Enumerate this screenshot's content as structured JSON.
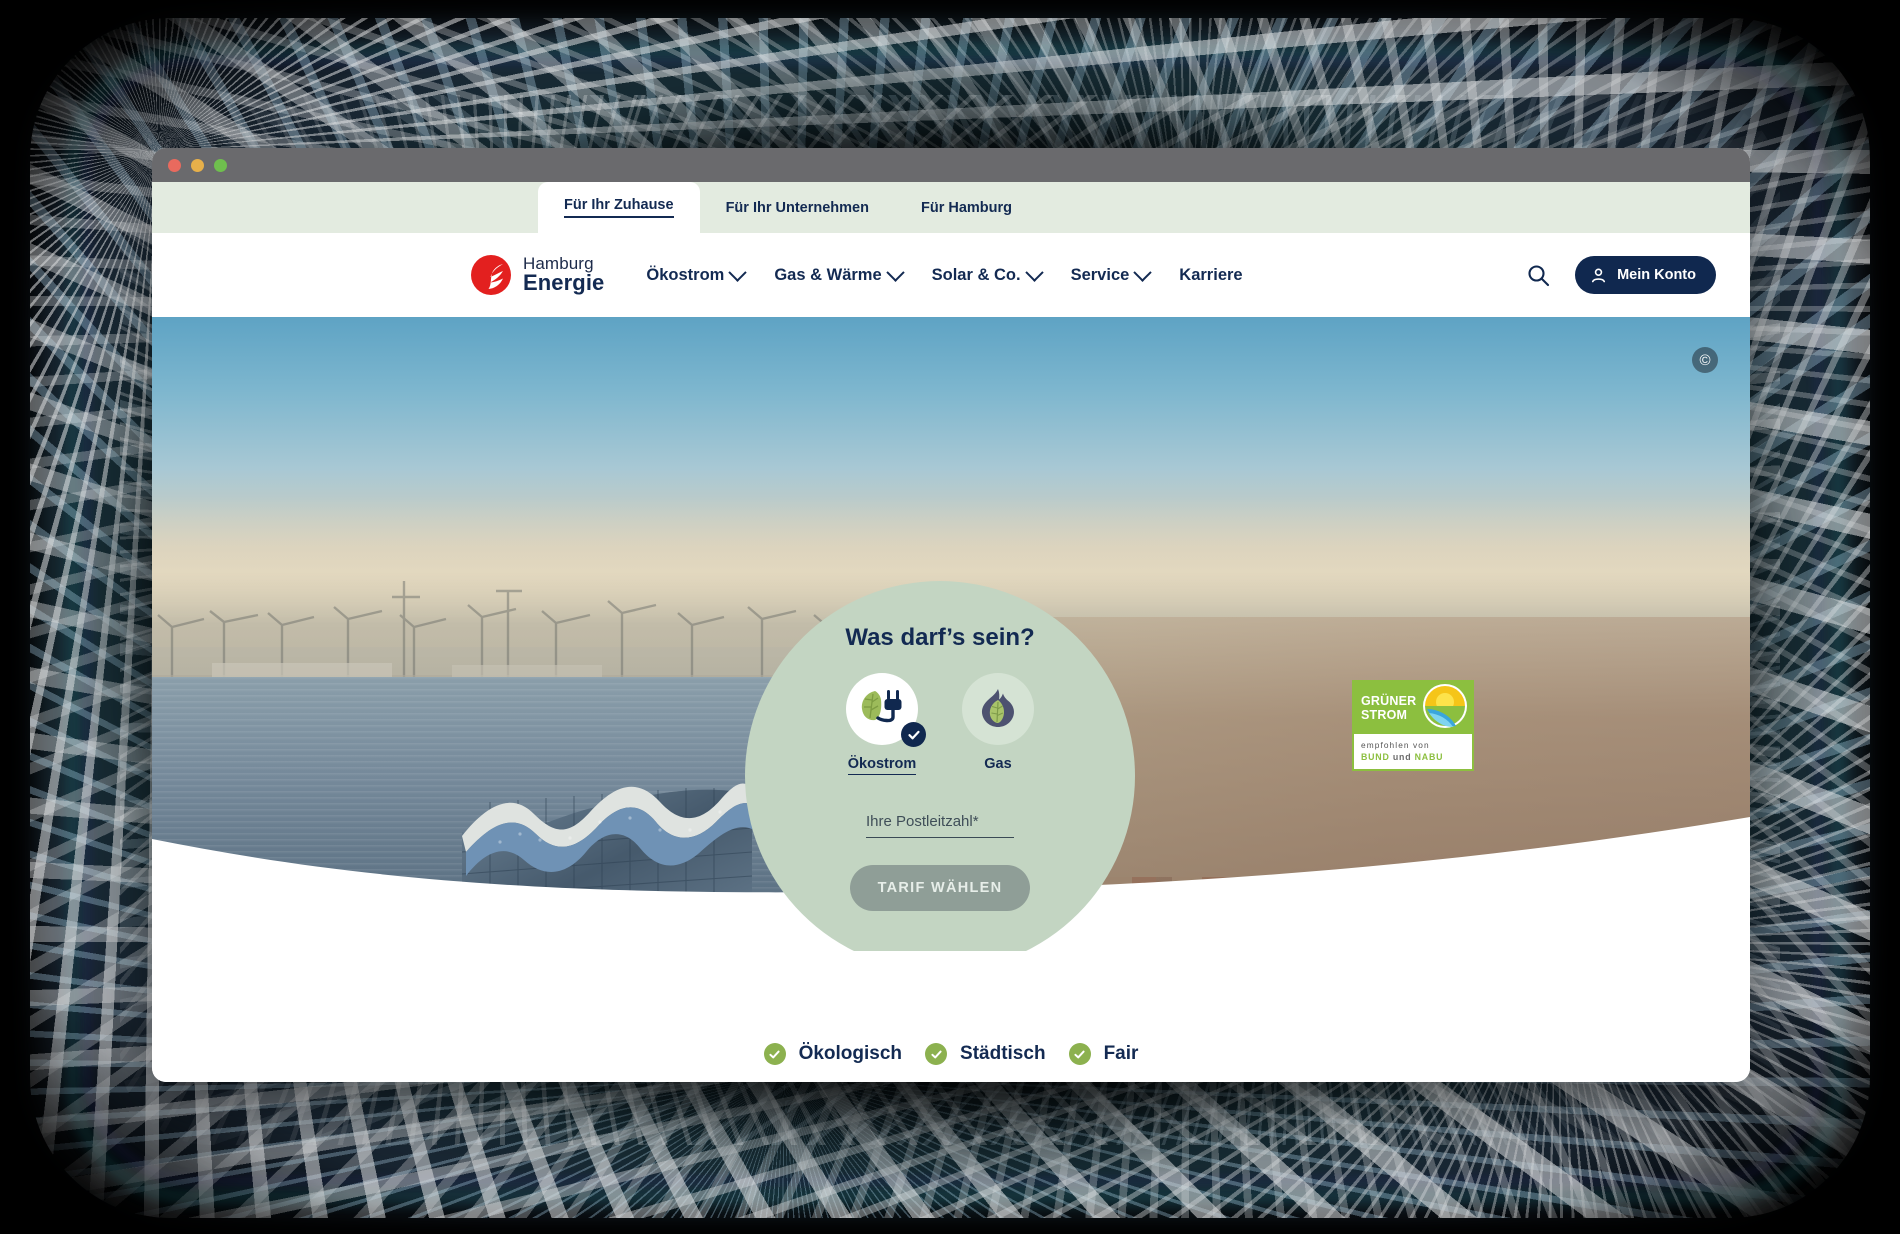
{
  "window": {
    "traffic_lights": [
      "close",
      "minimize",
      "maximize"
    ]
  },
  "topbar": {
    "tabs": [
      {
        "label": "Für Ihr Zuhause",
        "active": true
      },
      {
        "label": "Für Ihr Unternehmen",
        "active": false
      },
      {
        "label": "Für Hamburg",
        "active": false
      }
    ]
  },
  "nav": {
    "logo": {
      "line1": "Hamburg",
      "line2": "Energie",
      "icon": "hamburg-energie-flame-logo"
    },
    "links": [
      {
        "label": "Ökostrom",
        "has_dropdown": true
      },
      {
        "label": "Gas & Wärme",
        "has_dropdown": true
      },
      {
        "label": "Solar & Co.",
        "has_dropdown": true
      },
      {
        "label": "Service",
        "has_dropdown": true
      },
      {
        "label": "Karriere",
        "has_dropdown": false
      }
    ],
    "search_icon": "search-icon",
    "account": {
      "label": "Mein Konto",
      "icon": "user-icon"
    }
  },
  "hero": {
    "copyright_symbol": "©",
    "image_description": "Hamburg Elbphilharmonie and harbour skyline"
  },
  "widget": {
    "title": "Was darf’s sein?",
    "options": [
      {
        "label": "Ökostrom",
        "icon": "leaf-plug-icon",
        "selected": true
      },
      {
        "label": "Gas",
        "icon": "flame-leaf-icon",
        "selected": false
      }
    ],
    "zip": {
      "placeholder": "Ihre Postleitzahl*",
      "value": ""
    },
    "submit_label": "TARIF WÄHLEN"
  },
  "badge": {
    "title_line1": "GRÜNER",
    "title_line2": "STROM",
    "sub_line1": "empfohlen von",
    "sub_line2_a": "BUND",
    "sub_line2_b": "und",
    "sub_line2_c": "NABU",
    "logo_icon": "sun-landscape-icon"
  },
  "features": [
    {
      "label": "Ökologisch",
      "icon": "check-circle-icon"
    },
    {
      "label": "Städtisch",
      "icon": "check-circle-icon"
    },
    {
      "label": "Fair",
      "icon": "check-circle-icon"
    }
  ],
  "colors": {
    "navy": "#132a52",
    "brand_red": "#e3201f",
    "mint": "#c3d5c2",
    "topbar_green": "#e3ebe0",
    "accent_green": "#8cb14f",
    "badge_green": "#8cbf3f"
  }
}
